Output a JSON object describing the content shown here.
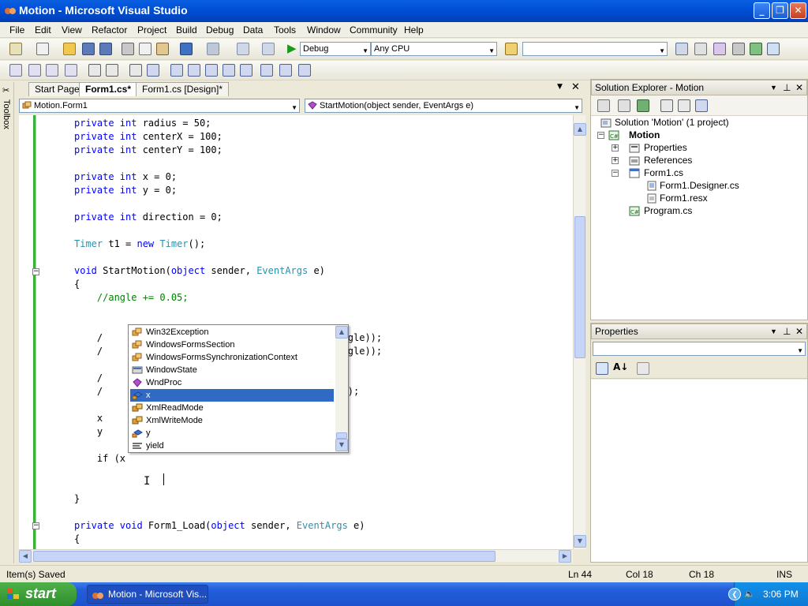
{
  "window": {
    "title": "Motion - Microsoft Visual Studio",
    "minimize_label": "_",
    "maximize_label": "❐",
    "close_label": "✕"
  },
  "menu": [
    "File",
    "Edit",
    "View",
    "Refactor",
    "Project",
    "Build",
    "Debug",
    "Data",
    "Tools",
    "Window",
    "Community",
    "Help"
  ],
  "toolbar": {
    "config": "Debug",
    "platform": "Any CPU",
    "find_value": ""
  },
  "toolbox_label": "Toolbox",
  "tabs": [
    {
      "label": "Start Page",
      "active": false
    },
    {
      "label": "Form1.cs*",
      "active": true
    },
    {
      "label": "Form1.cs [Design]*",
      "active": false
    }
  ],
  "nav": {
    "type": "Motion.Form1",
    "member": "StartMotion(object sender, EventArgs e)"
  },
  "code": [
    {
      "parts": [
        {
          "t": "private int ",
          "c": "kw"
        },
        {
          "t": "radius = 50;"
        }
      ]
    },
    {
      "parts": [
        {
          "t": "private int ",
          "c": "kw"
        },
        {
          "t": "centerX = 100;"
        }
      ]
    },
    {
      "parts": [
        {
          "t": "private int ",
          "c": "kw"
        },
        {
          "t": "centerY = 100;"
        }
      ]
    },
    {
      "parts": []
    },
    {
      "parts": [
        {
          "t": "private int ",
          "c": "kw"
        },
        {
          "t": "x = 0;"
        }
      ]
    },
    {
      "parts": [
        {
          "t": "private int ",
          "c": "kw"
        },
        {
          "t": "y = 0;"
        }
      ]
    },
    {
      "parts": []
    },
    {
      "parts": [
        {
          "t": "private int ",
          "c": "kw"
        },
        {
          "t": "direction = 0;"
        }
      ]
    },
    {
      "parts": []
    },
    {
      "parts": [
        {
          "t": "Timer",
          "c": "ty"
        },
        {
          "t": " t1 = "
        },
        {
          "t": "new ",
          "c": "kw"
        },
        {
          "t": "Timer",
          "c": "ty"
        },
        {
          "t": "();"
        }
      ]
    },
    {
      "parts": []
    },
    {
      "parts": [
        {
          "t": "void ",
          "c": "kw"
        },
        {
          "t": "StartMotion("
        },
        {
          "t": "object ",
          "c": "kw"
        },
        {
          "t": "sender, "
        },
        {
          "t": "EventArgs",
          "c": "ty"
        },
        {
          "t": " e)"
        }
      ]
    },
    {
      "parts": [
        {
          "t": "{"
        }
      ]
    },
    {
      "parts": [
        {
          "t": "    //angle += 0.05;",
          "c": "cm"
        }
      ]
    },
    {
      "parts": []
    },
    {
      "parts": []
    },
    {
      "parts": [
        {
          "t": "    /                                 ath.Cos(angle));"
        }
      ]
    },
    {
      "parts": [
        {
          "t": "    /                                 ath.Sin(angle));"
        }
      ]
    },
    {
      "parts": []
    },
    {
      "parts": [
        {
          "t": "    /"
        }
      ]
    },
    {
      "parts": [
        {
          "t": "    /                                 .ToString();"
        }
      ]
    },
    {
      "parts": []
    },
    {
      "parts": [
        {
          "t": "    x"
        }
      ]
    },
    {
      "parts": [
        {
          "t": "    y"
        }
      ]
    },
    {
      "parts": []
    },
    {
      "parts": [
        {
          "t": "    if (x"
        }
      ]
    },
    {
      "parts": []
    },
    {
      "parts": []
    },
    {
      "parts": [
        {
          "t": "}"
        }
      ]
    },
    {
      "parts": []
    },
    {
      "parts": [
        {
          "t": "private void ",
          "c": "kw"
        },
        {
          "t": "Form1_Load("
        },
        {
          "t": "object ",
          "c": "kw"
        },
        {
          "t": "sender, "
        },
        {
          "t": "EventArgs",
          "c": "ty"
        },
        {
          "t": " e)"
        }
      ]
    },
    {
      "parts": [
        {
          "t": "{"
        }
      ]
    }
  ],
  "intellisense": [
    {
      "label": "Win32Exception",
      "icon": "class-icon"
    },
    {
      "label": "WindowsFormsSection",
      "icon": "class-icon"
    },
    {
      "label": "WindowsFormsSynchronizationContext",
      "icon": "class-icon"
    },
    {
      "label": "WindowState",
      "icon": "property-icon"
    },
    {
      "label": "WndProc",
      "icon": "method-icon"
    },
    {
      "label": "x",
      "icon": "field-icon",
      "selected": true
    },
    {
      "label": "XmlReadMode",
      "icon": "enum-icon"
    },
    {
      "label": "XmlWriteMode",
      "icon": "enum-icon"
    },
    {
      "label": "y",
      "icon": "field-icon"
    },
    {
      "label": "yield",
      "icon": "keyword-icon"
    }
  ],
  "solution_explorer": {
    "title": "Solution Explorer - Motion",
    "items": [
      {
        "label": "Solution 'Motion' (1 project)",
        "bold": false
      },
      {
        "label": "Motion",
        "bold": true
      },
      {
        "label": "Properties",
        "bold": false
      },
      {
        "label": "References",
        "bold": false
      },
      {
        "label": "Form1.cs",
        "bold": false
      },
      {
        "label": "Form1.Designer.cs",
        "bold": false
      },
      {
        "label": "Form1.resx",
        "bold": false
      },
      {
        "label": "Program.cs",
        "bold": false
      }
    ]
  },
  "properties": {
    "title": "Properties"
  },
  "status": {
    "message": "Item(s) Saved",
    "ln": "Ln 44",
    "col": "Col 18",
    "ch": "Ch 18",
    "mode": "INS"
  },
  "taskbar": {
    "start": "start",
    "task": "Motion - Microsoft Vis...",
    "clock": "3:06 PM"
  },
  "colors": {
    "keyword": "#0000ff",
    "type": "#2b91af",
    "comment": "#008000",
    "selection": "#316ac5"
  }
}
